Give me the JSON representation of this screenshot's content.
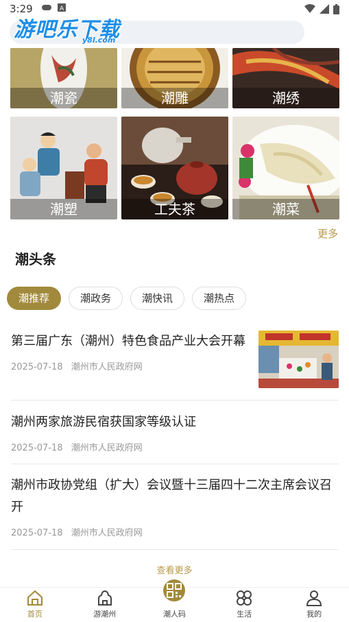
{
  "status_bar": {
    "time": "3:29"
  },
  "watermark": {
    "main": "游吧乐下载",
    "sub": "y8l.com"
  },
  "search": {
    "placeholder": ""
  },
  "categories": [
    {
      "label": "潮瓷"
    },
    {
      "label": "潮雕"
    },
    {
      "label": "潮绣"
    },
    {
      "label": "潮塑"
    },
    {
      "label": "工夫茶"
    },
    {
      "label": "潮菜"
    }
  ],
  "more_label": "更多",
  "section_title": "潮头条",
  "tabs": [
    "潮推荐",
    "潮政务",
    "潮快讯",
    "潮热点"
  ],
  "news": [
    {
      "title": "第三届广东（潮州）特色食品产业大会开幕",
      "date": "2025-07-18",
      "source": "潮州市人民政府网"
    },
    {
      "title": "潮州两家旅游民宿获国家等级认证",
      "date": "2025-07-18",
      "source": "潮州市人民政府网"
    },
    {
      "title": "潮州市政协党组（扩大）会议暨十三届四十二次主席会议召开",
      "date": "2025-07-18",
      "source": "潮州市人民政府网"
    }
  ],
  "see_more": "查看更多",
  "nav": [
    {
      "label": "首页",
      "icon": "home-icon"
    },
    {
      "label": "游潮州",
      "icon": "tour-icon"
    },
    {
      "label": "潮人码",
      "icon": "qr-code-icon"
    },
    {
      "label": "生活",
      "icon": "apps-icon"
    },
    {
      "label": "我的",
      "icon": "profile-icon"
    }
  ],
  "colors": {
    "accent": "#a28a3c",
    "link": "#b99a4a"
  }
}
